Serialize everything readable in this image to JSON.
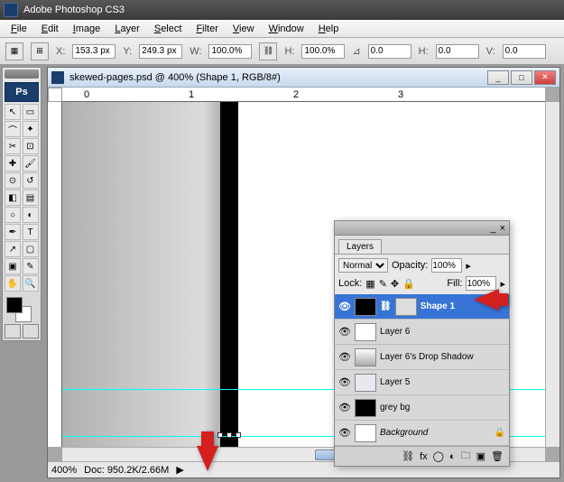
{
  "app": {
    "title": "Adobe Photoshop CS3"
  },
  "menu": [
    "File",
    "Edit",
    "Image",
    "Layer",
    "Select",
    "Filter",
    "View",
    "Window",
    "Help"
  ],
  "options": {
    "x_label": "X:",
    "x": "153.3 px",
    "y_label": "Y:",
    "y": "249.3 px",
    "w_label": "W:",
    "w": "100.0%",
    "h_label": "H:",
    "h": "100.0%",
    "angle_label": "",
    "angle": "0.0",
    "hskew_label": "H:",
    "hskew": "0.0",
    "vskew_label": "V:",
    "vskew": "0.0"
  },
  "document": {
    "title": "skewed-pages.psd @ 400% (Shape 1, RGB/8#)",
    "zoom": "400%",
    "docsize": "Doc: 950.2K/2.66M",
    "ruler_marks": [
      "0",
      "1",
      "2",
      "3"
    ]
  },
  "layers_panel": {
    "tab": "Layers",
    "blend": "Normal",
    "opacity_label": "Opacity:",
    "opacity": "100%",
    "lock_label": "Lock:",
    "fill_label": "Fill:",
    "fill": "100%",
    "items": [
      {
        "name": "Shape 1",
        "selected": true,
        "thumb": "#000",
        "mask": true
      },
      {
        "name": "Layer 6",
        "selected": false,
        "thumb": "#fff",
        "mask": false
      },
      {
        "name": "Layer 6's Drop Shadow",
        "selected": false,
        "thumb": "#888",
        "mask": false
      },
      {
        "name": "Layer 5",
        "selected": false,
        "thumb": "#eef",
        "mask": false
      },
      {
        "name": "grey bg",
        "selected": false,
        "thumb": "#000",
        "mask": false
      },
      {
        "name": "Background",
        "selected": false,
        "thumb": "#fff",
        "mask": false,
        "locked": true
      }
    ]
  }
}
